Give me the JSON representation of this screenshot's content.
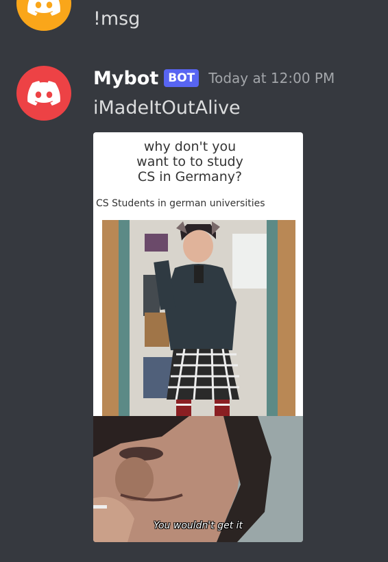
{
  "messages": [
    {
      "avatar": "discord-logo-icon",
      "avatar_color": "#faa61a",
      "text": "!msg"
    },
    {
      "avatar": "discord-logo-icon",
      "avatar_color": "#ed4245",
      "username": "Mybot",
      "tag": "BOT",
      "timestamp": "Today at 12:00 PM",
      "text": "iMadeItOutAlive",
      "attachment": {
        "title": "why don't you\nwant to to study\nCS in Germany?",
        "caption": "CS Students in german universities",
        "subtitle": "You wouldn't get it"
      }
    }
  ],
  "colors": {
    "background": "#36393f",
    "bot_tag": "#5865f2",
    "text": "#dcddde",
    "timestamp": "#a3a6aa"
  }
}
